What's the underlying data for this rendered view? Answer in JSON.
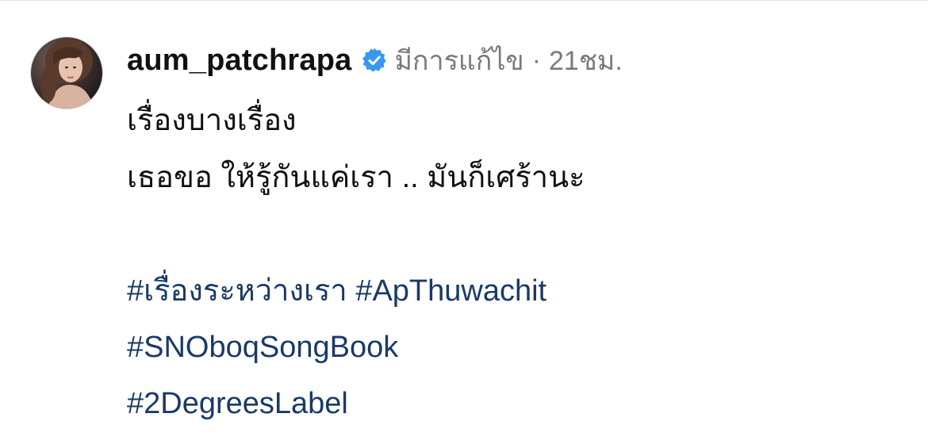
{
  "post": {
    "username": "aum_patchrapa",
    "edited_label": "มีการแก้ไข",
    "separator": "·",
    "timestamp": "21ชม.",
    "verified_icon": "verified-badge-icon",
    "avatar_icon": "profile-photo"
  },
  "caption": {
    "lines": [
      "เรื่องบางเรื่อง",
      "เธอขอ ให้รู้กันแค่เรา .. มันก็เศร้านะ"
    ]
  },
  "hashtags": {
    "line1": [
      "#เรื่องระหว่างเรา",
      "#ApThuwachit"
    ],
    "line2": [
      "#SNOboqSongBook"
    ],
    "line3": [
      "#2DegreesLabel"
    ]
  },
  "colors": {
    "hashtag": "#1a3a66",
    "verified": "#3897f0",
    "meta": "#7a7a7a",
    "text": "#111111"
  }
}
